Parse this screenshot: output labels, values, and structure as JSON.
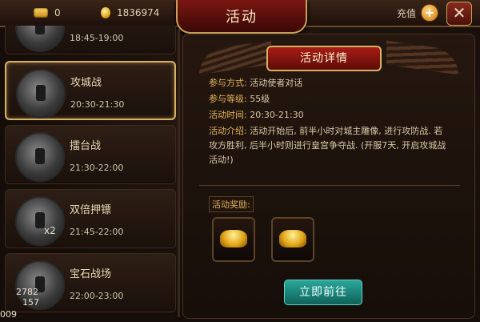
{
  "header": {
    "ingot_count": "0",
    "gold_count": "1836974",
    "title": "活动",
    "recharge_label": "充值",
    "plus_glyph": "+",
    "close_glyph": "✕"
  },
  "activities": [
    {
      "name": "",
      "time": "18:45-19:00",
      "selected": false
    },
    {
      "name": "攻城战",
      "time": "20:30-21:30",
      "selected": true
    },
    {
      "name": "擂台战",
      "time": "21:30-22:00",
      "selected": false
    },
    {
      "name": "双倍押镖",
      "time": "21:45-22:00",
      "selected": false,
      "badge": "x2"
    },
    {
      "name": "宝石战场",
      "time": "22:00-23:00",
      "selected": false
    }
  ],
  "side_counter": {
    "line1": "2782",
    "line2": "157",
    "line3": "009"
  },
  "detail": {
    "title": "活动详情",
    "method_label": "参与方式:",
    "method_value": "活动使者对话",
    "level_label": "参与等级:",
    "level_value": "55级",
    "time_label": "活动时间:",
    "time_value": "20:30-21:30",
    "intro_label": "活动介绍:",
    "intro_text": "活动开始后, 前半小时对城主雕像, 进行攻防战. 若攻方胜利, 后半小时则进行皇宫争夺战. (开服7天, 开启攻城战活动!)",
    "reward_label": "活动奖励:",
    "rewards": [
      {
        "icon": "gold-ingot-icon"
      },
      {
        "icon": "gold-ingot-icon"
      }
    ],
    "go_button": "立即前往"
  }
}
